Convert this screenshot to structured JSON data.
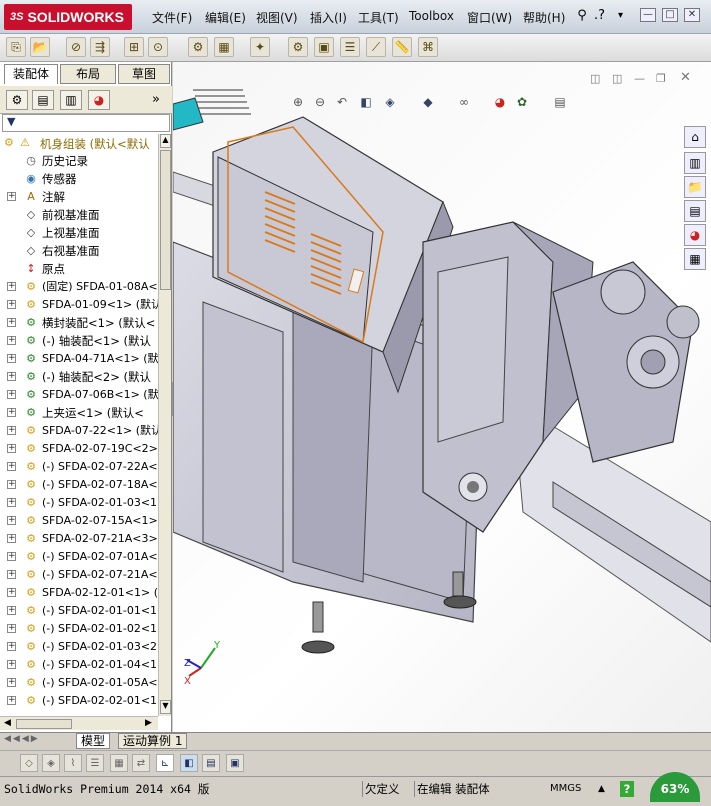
{
  "app": {
    "logo_text": "SOLIDWORKS",
    "logo_prefix": "3S"
  },
  "menu": [
    {
      "label": "文件(F)"
    },
    {
      "label": "编辑(E)"
    },
    {
      "label": "视图(V)"
    },
    {
      "label": "插入(I)"
    },
    {
      "label": "工具(T)"
    },
    {
      "label": "Toolbox"
    },
    {
      "label": "窗口(W)"
    },
    {
      "label": "帮助(H)"
    }
  ],
  "window_controls": {
    "help": "?",
    "minimize": "—",
    "maximize": "□",
    "close": "✕"
  },
  "panel_tabs": [
    {
      "label": "装配体"
    },
    {
      "label": "布局"
    },
    {
      "label": "草图"
    }
  ],
  "tree": {
    "root": "机身组装  (默认<默认",
    "items": [
      {
        "text": "历史记录",
        "icon": "history-icon",
        "exp": false,
        "mono": false
      },
      {
        "text": "传感器",
        "icon": "sensor-icon",
        "exp": false,
        "mono": false
      },
      {
        "text": "注解",
        "icon": "annotation-icon",
        "exp": true,
        "mono": false
      },
      {
        "text": "前视基准面",
        "icon": "plane-icon",
        "exp": false,
        "mono": false
      },
      {
        "text": "上视基准面",
        "icon": "plane-icon",
        "exp": false,
        "mono": false
      },
      {
        "text": "右视基准面",
        "icon": "plane-icon",
        "exp": false,
        "mono": false
      },
      {
        "text": "原点",
        "icon": "origin-icon",
        "exp": false,
        "mono": false
      },
      {
        "text": "(固定) SFDA-01-08A<",
        "icon": "part-icon",
        "exp": true,
        "mono": true
      },
      {
        "text": "SFDA-01-09<1> (默认",
        "icon": "part-icon",
        "exp": true,
        "mono": true
      },
      {
        "text": "横封装配<1> (默认<",
        "icon": "assembly-icon",
        "exp": true,
        "mono": false
      },
      {
        "text": "(-) 轴装配<1> (默认",
        "icon": "assembly-icon",
        "exp": true,
        "mono": false
      },
      {
        "text": "SFDA-04-71A<1> (默",
        "icon": "assembly-icon",
        "exp": true,
        "mono": true
      },
      {
        "text": "(-) 轴装配<2> (默认",
        "icon": "assembly-icon",
        "exp": true,
        "mono": false
      },
      {
        "text": "SFDA-07-06B<1> (默",
        "icon": "assembly-icon",
        "exp": true,
        "mono": true
      },
      {
        "text": "上夹运<1> (默认<",
        "icon": "assembly-icon",
        "exp": true,
        "mono": false
      },
      {
        "text": "SFDA-07-22<1> (默认",
        "icon": "part-icon",
        "exp": true,
        "mono": true
      },
      {
        "text": "SFDA-02-07-19C<2>",
        "icon": "part-icon",
        "exp": true,
        "mono": true
      },
      {
        "text": "(-) SFDA-02-07-22A<",
        "icon": "part-icon",
        "exp": true,
        "mono": true
      },
      {
        "text": "(-) SFDA-02-07-18A<",
        "icon": "part-icon",
        "exp": true,
        "mono": true
      },
      {
        "text": "(-) SFDA-02-01-03<1",
        "icon": "part-icon",
        "exp": true,
        "mono": true
      },
      {
        "text": "SFDA-02-07-15A<1>",
        "icon": "part-icon",
        "exp": true,
        "mono": true
      },
      {
        "text": "SFDA-02-07-21A<3>",
        "icon": "part-icon",
        "exp": true,
        "mono": true
      },
      {
        "text": "(-) SFDA-02-07-01A<",
        "icon": "part-icon",
        "exp": true,
        "mono": true
      },
      {
        "text": "(-) SFDA-02-07-21A<",
        "icon": "part-icon",
        "exp": true,
        "mono": true
      },
      {
        "text": "SFDA-02-12-01<1> (",
        "icon": "part-icon",
        "exp": true,
        "mono": true
      },
      {
        "text": "(-) SFDA-02-01-01<1",
        "icon": "part-icon",
        "exp": true,
        "mono": true
      },
      {
        "text": "(-) SFDA-02-01-02<1",
        "icon": "part-icon",
        "exp": true,
        "mono": true
      },
      {
        "text": "(-) SFDA-02-01-03<2",
        "icon": "part-icon",
        "exp": true,
        "mono": true
      },
      {
        "text": "(-) SFDA-02-01-04<1",
        "icon": "part-icon",
        "exp": true,
        "mono": true
      },
      {
        "text": "(-) SFDA-02-01-05A<",
        "icon": "part-icon",
        "exp": true,
        "mono": true
      },
      {
        "text": "(-) SFDA-02-02-01<1",
        "icon": "part-icon",
        "exp": true,
        "mono": true
      }
    ]
  },
  "bottom_tabs": [
    {
      "label": "模型"
    },
    {
      "label": "运动算例 1"
    }
  ],
  "status": {
    "product": "SolidWorks Premium 2014 x64 版",
    "underdefined": "欠定义",
    "editing": "在编辑 装配体",
    "units": "MMGS",
    "units_arrow": "▲",
    "help": "?",
    "zoom": "63%"
  },
  "triad": {
    "x": "X",
    "y": "Y",
    "z": "Z"
  },
  "colors": {
    "accent": "#c8102e",
    "part_icon": "#d4a017",
    "model_body": "#c9c9d6",
    "vent": "#d97a1f"
  }
}
